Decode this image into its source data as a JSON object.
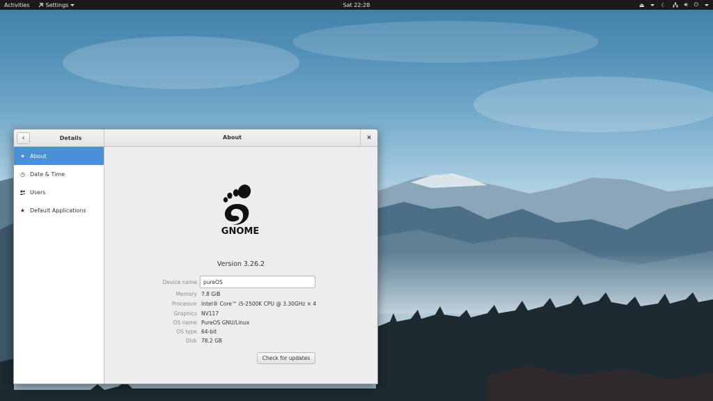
{
  "topbar": {
    "activities": "Activities",
    "app_menu": "Settings",
    "clock": "Sat 22:28",
    "tray_icons": [
      "eject-icon",
      "moon-icon",
      "network-icon",
      "volume-icon",
      "power-icon"
    ]
  },
  "window": {
    "sidebar_title": "Details",
    "content_title": "About",
    "back_symbol": "‹",
    "close_symbol": "×"
  },
  "sidebar": {
    "items": [
      {
        "label": "About",
        "icon": "sparkle-icon",
        "glyph": "✦",
        "active": true
      },
      {
        "label": "Date & Time",
        "icon": "clock-icon",
        "glyph": "◷",
        "active": false
      },
      {
        "label": "Users",
        "icon": "users-icon",
        "glyph": "👥",
        "active": false
      },
      {
        "label": "Default Applications",
        "icon": "star-icon",
        "glyph": "★",
        "active": false
      }
    ]
  },
  "about": {
    "logo_text": "GNOME",
    "version": "Version 3.26.2",
    "device_name_label": "Device name",
    "device_name_value": "pureOS",
    "memory_label": "Memory",
    "memory_value": "7.8 GiB",
    "processor_label": "Processor",
    "processor_value": "Intel® Core™ i5-2500K CPU @ 3.30GHz × 4",
    "graphics_label": "Graphics",
    "graphics_value": "NV117",
    "os_name_label": "OS name",
    "os_name_value": "PureOS GNU/Linux",
    "os_type_label": "OS type",
    "os_type_value": "64-bit",
    "disk_label": "Disk",
    "disk_value": "78.2 GB",
    "check_updates": "Check for updates"
  },
  "colors": {
    "accent": "#4a90d9",
    "topbar": "#1a1a1a"
  }
}
